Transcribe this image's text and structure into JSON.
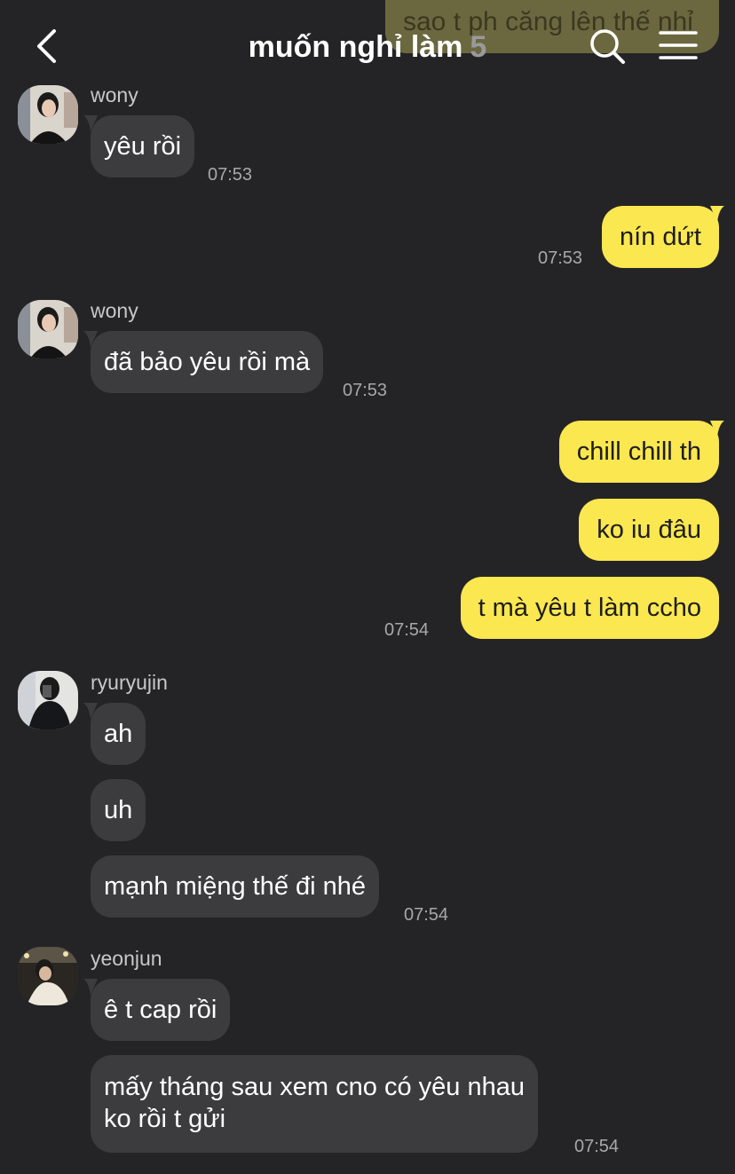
{
  "header": {
    "title": "muốn nghỉ làm",
    "member_count": "5",
    "back_icon": "chevron-left-icon",
    "search_icon": "search-icon",
    "menu_icon": "hamburger-menu-icon"
  },
  "peek_message": "sao t ph căng lên thế nhỉ",
  "colors": {
    "background": "#242426",
    "incoming_bubble": "#3c3c3e",
    "outgoing_bubble": "#fbe74f"
  },
  "messages": {
    "m1": {
      "sender": "wony",
      "text": "yêu rồi",
      "time": "07:53"
    },
    "m2": {
      "text": "nín dứt",
      "time": "07:53"
    },
    "m3": {
      "sender": "wony",
      "text": "đã bảo yêu rồi mà",
      "time": "07:53"
    },
    "m4": {
      "texts": [
        "chill chill th",
        "ko iu đâu",
        "t mà yêu t làm ccho"
      ],
      "time": "07:54"
    },
    "m5": {
      "sender": "ryuryujin",
      "texts": [
        "ah",
        "uh",
        "mạnh miệng thế đi nhé"
      ],
      "time": "07:54"
    },
    "m6": {
      "sender": "yeonjun",
      "texts": [
        "ê t cap rồi",
        "mấy tháng sau xem cno có yêu nhau",
        "ko rồi t gửi"
      ],
      "time": "07:54"
    }
  }
}
